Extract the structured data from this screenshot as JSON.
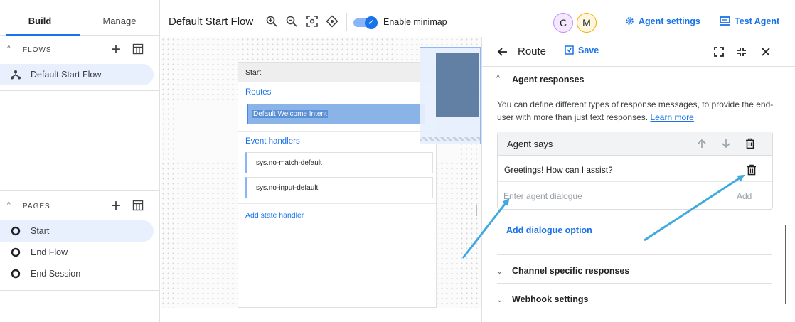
{
  "sidebar": {
    "tabs": [
      {
        "label": "Build"
      },
      {
        "label": "Manage"
      }
    ],
    "flows": {
      "header": "FLOWS",
      "items": [
        {
          "label": "Default Start Flow"
        }
      ]
    },
    "pages": {
      "header": "PAGES",
      "items": [
        {
          "label": "Start"
        },
        {
          "label": "End Flow"
        },
        {
          "label": "End Session"
        }
      ]
    }
  },
  "toolbar": {
    "title": "Default Start Flow",
    "minimap_label": "Enable minimap",
    "minimap_enabled": true,
    "avatars": [
      {
        "letter": "C",
        "color": "#f3e8fd",
        "border": "#c58af9"
      },
      {
        "letter": "M",
        "color": "#fef7e0",
        "border": "#f9ab00"
      }
    ],
    "agent_settings": "Agent settings",
    "test_agent": "Test Agent"
  },
  "canvas": {
    "node_title": "Start",
    "routes_label": "Routes",
    "route_selected": "Default Welcome Intent",
    "event_handlers_label": "Event handlers",
    "handlers": [
      "sys.no-match-default",
      "sys.no-input-default"
    ],
    "add_state_handler": "Add state handler"
  },
  "panel": {
    "title": "Route",
    "save_label": "Save",
    "agent_responses_title": "Agent responses",
    "description": "You can define different types of response messages, to provide the end-user with more than just text responses.",
    "learn_more": "Learn more",
    "card_title": "Agent says",
    "dialogue": "Greetings! How can I assist?",
    "input_placeholder": "Enter agent dialogue",
    "add_label": "Add",
    "add_dialogue_option": "Add dialogue option",
    "channel_specific": "Channel specific responses",
    "webhook_settings": "Webhook settings"
  },
  "colors": {
    "accent": "#1a73e8",
    "selected_bg": "#e8f0fe",
    "arrow": "#3fa9e0"
  }
}
